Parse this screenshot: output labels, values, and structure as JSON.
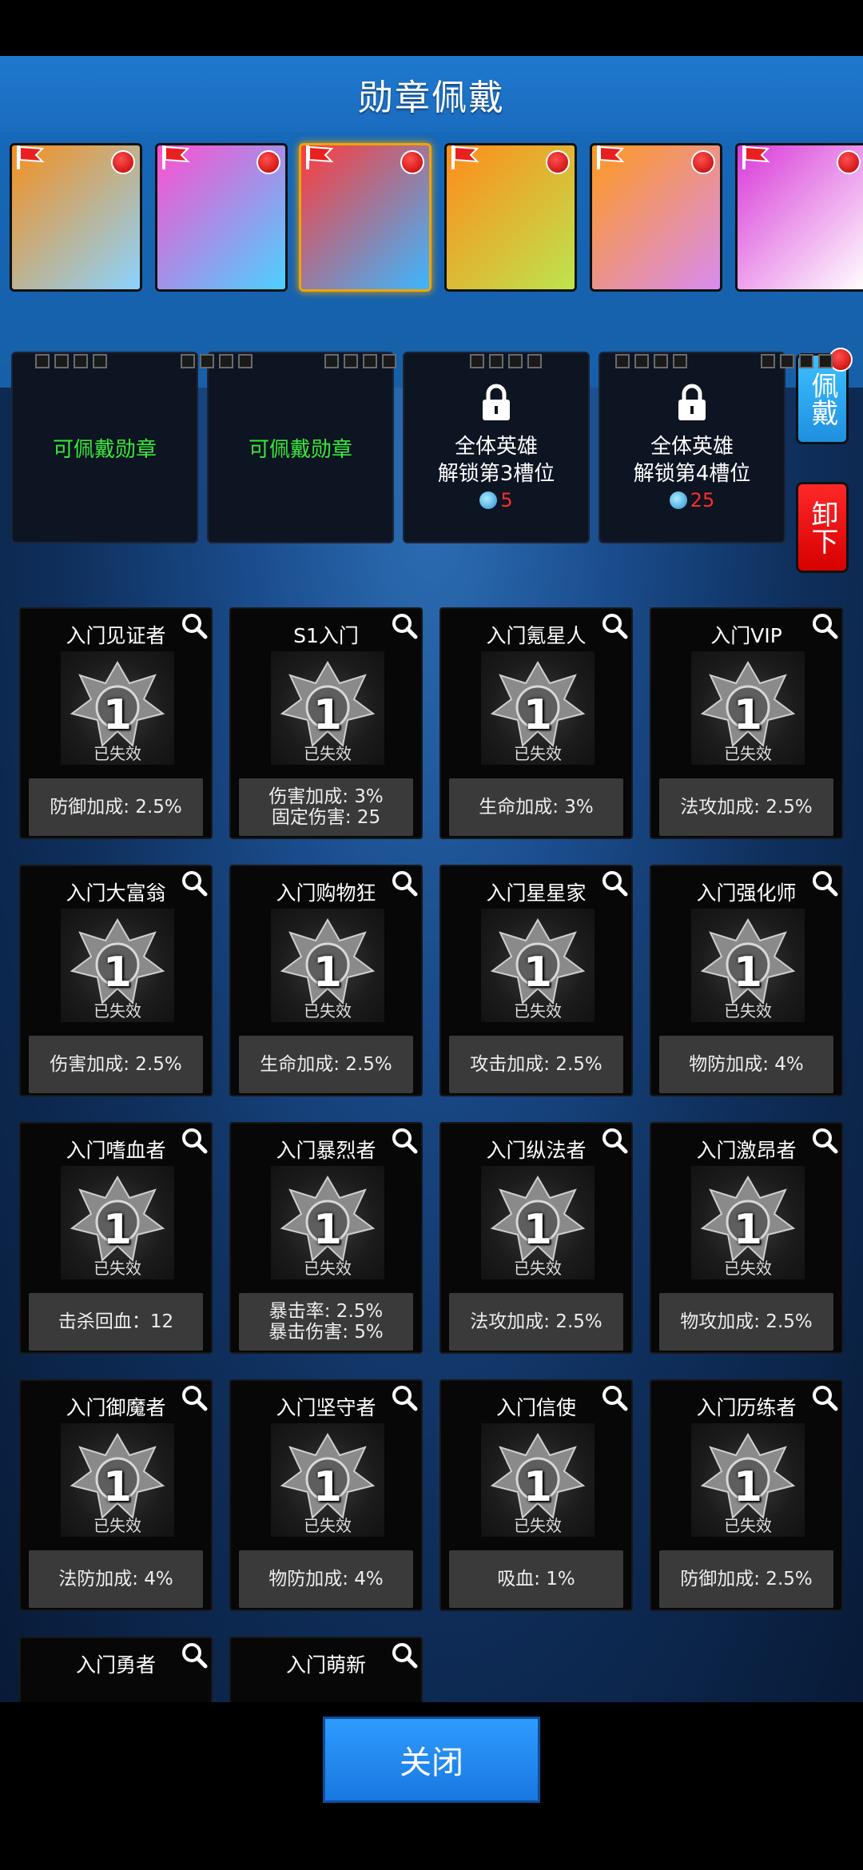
{
  "header": {
    "title": "勋章佩戴"
  },
  "heroes": [
    {
      "name": "hero-1",
      "colors": [
        "#f5901e",
        "#8bd3ff"
      ],
      "selected": false
    },
    {
      "name": "hero-2",
      "colors": [
        "#ff4fd0",
        "#4bd1ff"
      ],
      "selected": false
    },
    {
      "name": "hero-3",
      "colors": [
        "#ff3b3b",
        "#3bb7ff"
      ],
      "selected": true
    },
    {
      "name": "hero-4",
      "colors": [
        "#ff8c1a",
        "#bde44e"
      ],
      "selected": false
    },
    {
      "name": "hero-5",
      "colors": [
        "#ff9a1f",
        "#d88cf0"
      ],
      "selected": false
    },
    {
      "name": "hero-6",
      "colors": [
        "#d93ad8",
        "#ffffff"
      ],
      "selected": false
    }
  ],
  "slots": [
    {
      "type": "open",
      "label": "可佩戴勋章"
    },
    {
      "type": "open",
      "label": "可佩戴勋章"
    },
    {
      "type": "locked",
      "line1": "全体英雄",
      "line2": "解锁第3槽位",
      "cost": "5"
    },
    {
      "type": "locked",
      "line1": "全体英雄",
      "line2": "解锁第4槽位",
      "cost": "25"
    }
  ],
  "actions": {
    "wear": "佩戴",
    "remove": "卸下",
    "close": "关闭"
  },
  "medal_common": {
    "level": "1",
    "status": "已失效"
  },
  "medals": [
    {
      "name": "入门见证者",
      "stats": [
        "防御加成: 2.5%"
      ]
    },
    {
      "name": "S1入门",
      "stats": [
        "伤害加成: 3%",
        "固定伤害: 25"
      ]
    },
    {
      "name": "入门氪星人",
      "stats": [
        "生命加成: 3%"
      ]
    },
    {
      "name": "入门VIP",
      "stats": [
        "法攻加成: 2.5%"
      ]
    },
    {
      "name": "入门大富翁",
      "stats": [
        "伤害加成: 2.5%"
      ]
    },
    {
      "name": "入门购物狂",
      "stats": [
        "生命加成: 2.5%"
      ]
    },
    {
      "name": "入门星星家",
      "stats": [
        "攻击加成: 2.5%"
      ]
    },
    {
      "name": "入门强化师",
      "stats": [
        "物防加成: 4%"
      ]
    },
    {
      "name": "入门嗜血者",
      "stats": [
        "击杀回血：12"
      ]
    },
    {
      "name": "入门暴烈者",
      "stats": [
        "暴击率: 2.5%",
        "暴击伤害: 5%"
      ]
    },
    {
      "name": "入门纵法者",
      "stats": [
        "法攻加成: 2.5%"
      ]
    },
    {
      "name": "入门激昂者",
      "stats": [
        "物攻加成: 2.5%"
      ]
    },
    {
      "name": "入门御魔者",
      "stats": [
        "法防加成: 4%"
      ]
    },
    {
      "name": "入门坚守者",
      "stats": [
        "物防加成: 4%"
      ]
    },
    {
      "name": "入门信使",
      "stats": [
        "吸血: 1%"
      ]
    },
    {
      "name": "入门历练者",
      "stats": [
        "防御加成: 2.5%"
      ]
    },
    {
      "name": "入门勇者",
      "stats": []
    },
    {
      "name": "入门萌新",
      "stats": []
    }
  ],
  "colors": {
    "accent": "#1f78cf",
    "locked_cost": "#ff2b2b",
    "open_slot_text": "#38e838"
  }
}
